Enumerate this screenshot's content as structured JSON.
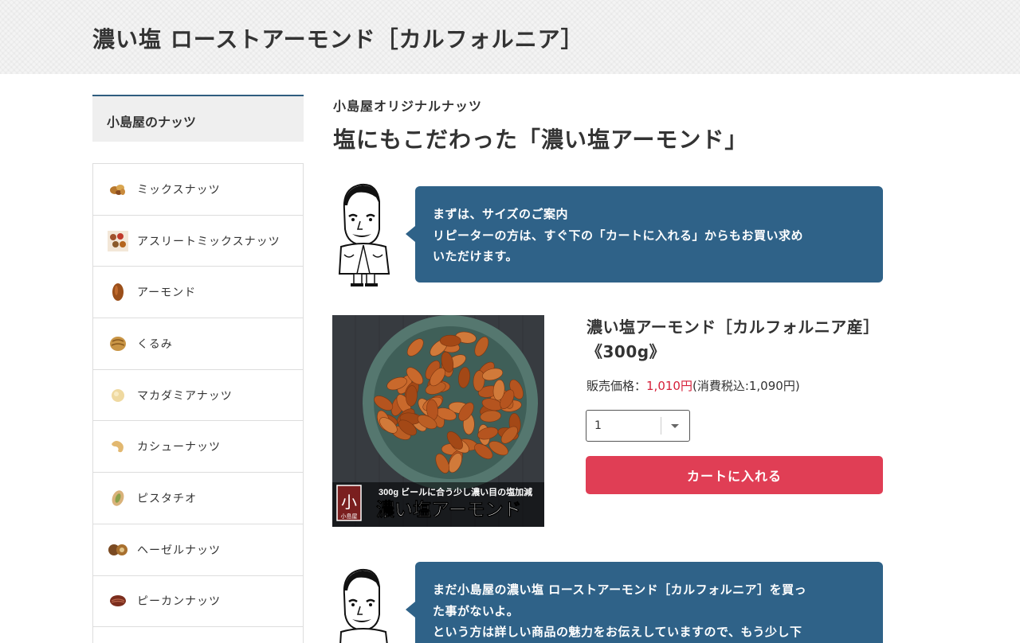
{
  "header": {
    "title": "濃い塩 ローストアーモンド［カルフォルニア］"
  },
  "sidebar": {
    "heading": "小島屋のナッツ",
    "items": [
      {
        "label": "ミックスナッツ",
        "icon": "mixed-nuts-icon"
      },
      {
        "label": "アスリートミックスナッツ",
        "icon": "athlete-mix-icon"
      },
      {
        "label": "アーモンド",
        "icon": "almond-icon"
      },
      {
        "label": "くるみ",
        "icon": "walnut-icon"
      },
      {
        "label": "マカダミアナッツ",
        "icon": "macadamia-icon"
      },
      {
        "label": "カシューナッツ",
        "icon": "cashew-icon"
      },
      {
        "label": "ピスタチオ",
        "icon": "pistachio-icon"
      },
      {
        "label": "ヘーゼルナッツ",
        "icon": "hazelnut-icon"
      },
      {
        "label": "ピーカンナッツ",
        "icon": "pecan-icon"
      }
    ]
  },
  "main": {
    "subtitle": "小島屋オリジナルナッツ",
    "title": "塩にもこだわった「濃い塩アーモンド」",
    "bubble1": {
      "lines": [
        "まずは、サイズのご案内",
        "リピーターの方は、すぐ下の「カートに入れる」からもお買い求め",
        "いただけます。"
      ]
    },
    "product": {
      "name": "濃い塩アーモンド［カルフォルニア産］《300g》",
      "price_label": "販売価格：",
      "price": "1,010円",
      "tax_text": "(消費税込:1,090円)",
      "quantity": "1",
      "cart_label": "カートに入れる",
      "image_banner_top": "300g  ビールに合う少し濃い目の塩加減",
      "image_banner_main": "濃い塩アーモンド",
      "image_logo_text": "小島屋"
    },
    "bubble2": {
      "lines": [
        "まだ小島屋の濃い塩 ローストアーモンド［カルフォルニア］を買っ",
        "た事がないよ。",
        "という方は詳しい商品の魅力をお伝えしていますので、もう少し下"
      ]
    }
  },
  "colors": {
    "accent_blue": "#2f6288",
    "cart_red": "#e03e55",
    "price_red": "#d6203a",
    "sidebar_border": "#2f5d7f"
  }
}
